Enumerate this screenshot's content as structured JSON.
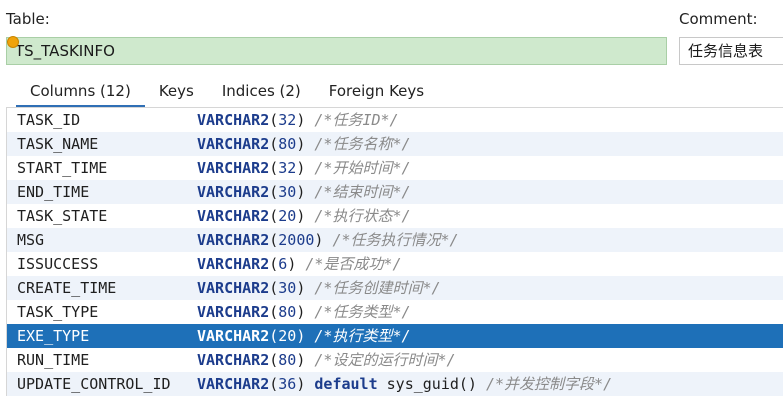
{
  "header": {
    "table_label": "Table:",
    "table_name": "TS_TASKINFO",
    "comment_label": "Comment:",
    "comment_value": "任务信息表"
  },
  "tabs": [
    {
      "label": "Columns (12)",
      "active": true
    },
    {
      "label": "Keys",
      "active": false
    },
    {
      "label": "Indices (2)",
      "active": false
    },
    {
      "label": "Foreign Keys",
      "active": false
    }
  ],
  "columns": [
    {
      "name": "TASK_ID",
      "type": "VARCHAR2",
      "size": "32",
      "extra": "",
      "comment": "/*任务ID*/"
    },
    {
      "name": "TASK_NAME",
      "type": "VARCHAR2",
      "size": "80",
      "extra": "",
      "comment": "/*任务名称*/"
    },
    {
      "name": "START_TIME",
      "type": "VARCHAR2",
      "size": "32",
      "extra": "",
      "comment": "/*开始时间*/"
    },
    {
      "name": "END_TIME",
      "type": "VARCHAR2",
      "size": "30",
      "extra": "",
      "comment": "/*结束时间*/"
    },
    {
      "name": "TASK_STATE",
      "type": "VARCHAR2",
      "size": "20",
      "extra": "",
      "comment": "/*执行状态*/"
    },
    {
      "name": "MSG",
      "type": "VARCHAR2",
      "size": "2000",
      "extra": "",
      "comment": "/*任务执行情况*/"
    },
    {
      "name": "ISSUCCESS",
      "type": "VARCHAR2",
      "size": "6",
      "extra": "",
      "comment": "/*是否成功*/"
    },
    {
      "name": "CREATE_TIME",
      "type": "VARCHAR2",
      "size": "30",
      "extra": "",
      "comment": "/*任务创建时间*/"
    },
    {
      "name": "TASK_TYPE",
      "type": "VARCHAR2",
      "size": "80",
      "extra": "",
      "comment": "/*任务类型*/"
    },
    {
      "name": "EXE_TYPE",
      "type": "VARCHAR2",
      "size": "20",
      "extra": "",
      "comment": "/*执行类型*/",
      "selected": true
    },
    {
      "name": "RUN_TIME",
      "type": "VARCHAR2",
      "size": "80",
      "extra": "",
      "comment": "/*设定的运行时间*/"
    },
    {
      "name": "UPDATE_CONTROL_ID",
      "type": "VARCHAR2",
      "size": "36",
      "extra_kw": "default",
      "extra_fn": "sys_guid()",
      "comment": "/*并发控制字段*/"
    }
  ],
  "colors": {
    "table_name_bg": "#cfe9cd",
    "selection": "#1e70b8",
    "tab_underline": "#2f6fb5",
    "type_keyword": "#1c3c8c",
    "comment_text": "#8a8a8a"
  }
}
